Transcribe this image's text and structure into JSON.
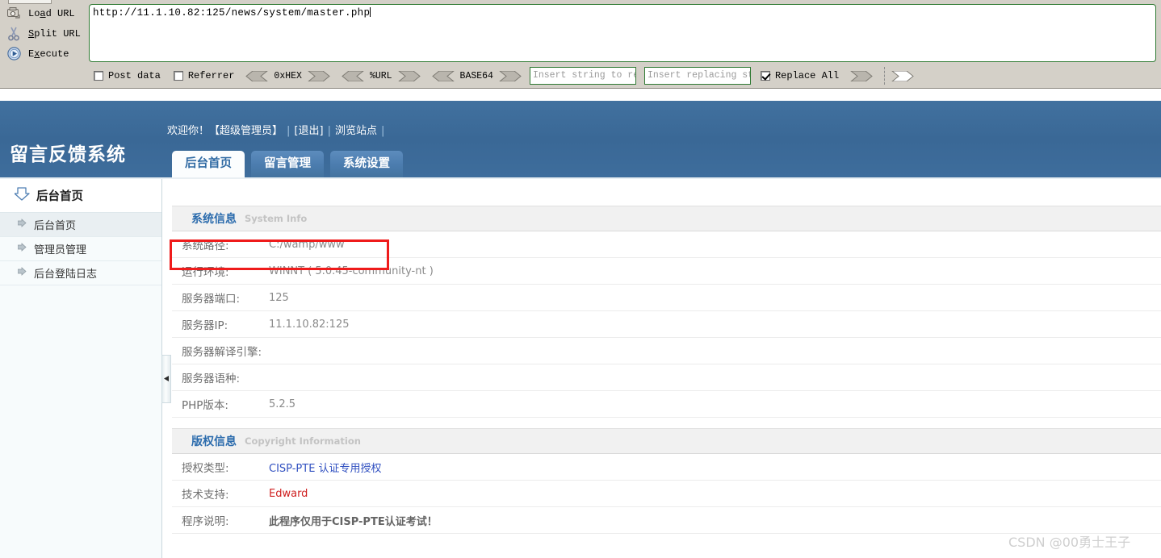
{
  "hackbar": {
    "buttons": [
      {
        "icon": "load-url-icon",
        "label": "Load URL",
        "accesskey": "a"
      },
      {
        "icon": "scissors-icon",
        "label": "Split URL",
        "accesskey": "S"
      },
      {
        "icon": "play-icon",
        "label": "Execute",
        "accesskey": "x"
      }
    ],
    "url_value": "http://11.1.10.82:125/news/system/master.php",
    "checkboxes": [
      {
        "label": "Post data",
        "checked": false
      },
      {
        "label": "Referrer",
        "checked": false
      },
      {
        "label": "Replace All",
        "checked": true
      }
    ],
    "encoders": [
      "0xHEX",
      "%URL",
      "BASE64"
    ],
    "replace_from_placeholder": "Insert string to replace",
    "replace_to_placeholder": "Insert replacing string",
    "replace_from_value": "",
    "replace_to_value": ""
  },
  "header": {
    "logo": "留言反馈系统",
    "welcome_prefix": "欢迎你！",
    "welcome_user": "【超级管理员】",
    "logout_label": "[退出]",
    "browse_site_label": "浏览站点",
    "tabs": [
      {
        "label": "后台首页",
        "active": true
      },
      {
        "label": "留言管理",
        "active": false
      },
      {
        "label": "系统设置",
        "active": false
      }
    ]
  },
  "sidebar": {
    "title": "后台首页",
    "title_icon": "down-arrow-icon",
    "items": [
      {
        "label": "后台首页",
        "active": true
      },
      {
        "label": "管理员管理",
        "active": false
      },
      {
        "label": "后台登陆日志",
        "active": false
      }
    ],
    "collapse_icon": "collapse-left-icon"
  },
  "main": {
    "panels": [
      {
        "title_cn": "系统信息",
        "title_en": "System Info",
        "rows": [
          {
            "key": "系统路径:",
            "value": "C:/wamp/www",
            "style": "plain",
            "highlighted": true
          },
          {
            "key": "运行环境:",
            "value": "WINNT ( 5.0.45-community-nt )",
            "style": "plain"
          },
          {
            "key": "服务器端口:",
            "value": "125",
            "style": "plain"
          },
          {
            "key": "服务器IP:",
            "value": "11.1.10.82:125",
            "style": "plain"
          },
          {
            "key": "服务器解译引擎:",
            "value": "",
            "style": "plain"
          },
          {
            "key": "服务器语种:",
            "value": "",
            "style": "plain"
          },
          {
            "key": "PHP版本:",
            "value": "5.2.5",
            "style": "plain"
          }
        ]
      },
      {
        "title_cn": "版权信息",
        "title_en": "Copyright Information",
        "rows": [
          {
            "key": "授权类型:",
            "value": "CISP-PTE 认证专用授权",
            "style": "blue"
          },
          {
            "key": "技术支持:",
            "value": "Edward",
            "style": "red"
          },
          {
            "key": "程序说明:",
            "value": "此程序仅用于CISP-PTE认证考试！",
            "style": "dark"
          }
        ]
      }
    ]
  },
  "watermark": {
    "text": "CSDN @00勇士王子"
  },
  "colors": {
    "header_blue": "#3d6ea0",
    "tab_active_text": "#2f6aa3",
    "panel_title": "#2c6cad",
    "annotation_red": "#ef1b1b",
    "link_blue": "#2f4fc0",
    "support_red": "#cf2020",
    "toolbar_bg": "#d4d0c8",
    "input_border_green": "#2f7a33"
  }
}
